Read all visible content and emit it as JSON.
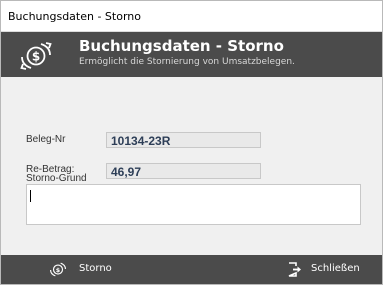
{
  "window": {
    "title": "Buchungsdaten - Storno"
  },
  "header": {
    "icon": "refund-dollar-icon",
    "title": "Buchungsdaten - Storno",
    "subtitle": "Ermöglicht die Stornierung von Umsatzbelegen."
  },
  "form": {
    "beleg_nr": {
      "label": "Beleg-Nr",
      "value": "10134-23R"
    },
    "re_betrag": {
      "label": "Re-Betrag:",
      "value": "46,97"
    },
    "storno_grund": {
      "label": "Storno-Grund",
      "value": ""
    }
  },
  "footer": {
    "storno_button": {
      "label": "Storno",
      "icon": "refund-dollar-icon"
    },
    "close_button": {
      "label": "Schließen",
      "icon": "exit-icon"
    }
  },
  "colors": {
    "header_bg": "#4b4b4b",
    "value_text": "#2d3e57"
  }
}
